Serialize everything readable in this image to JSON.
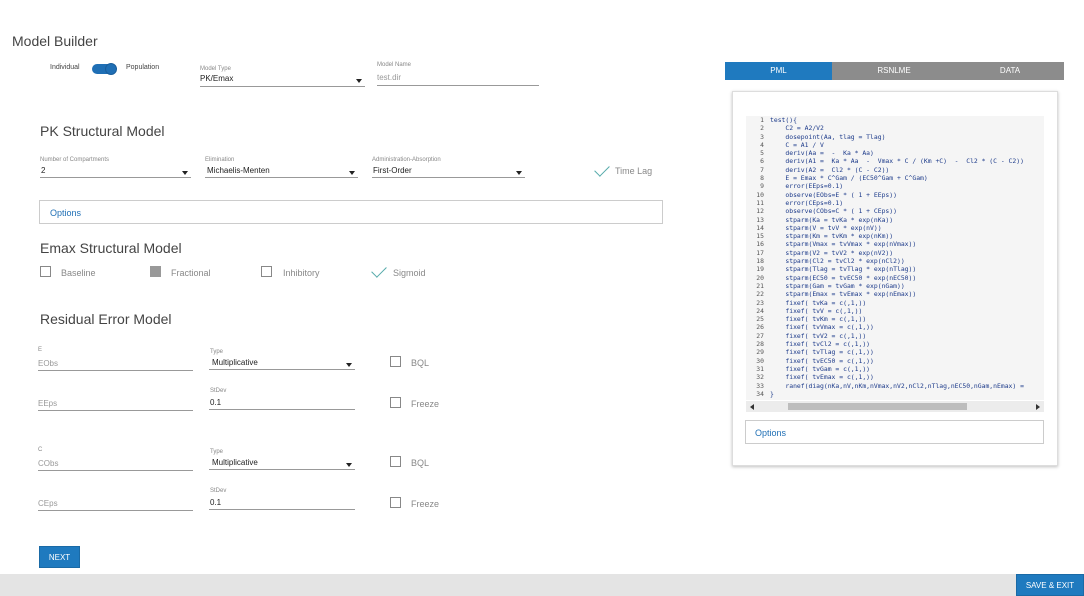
{
  "app": {
    "title": "Model Builder"
  },
  "mode_toggle": {
    "left_label": "Individual",
    "right_label": "Population"
  },
  "model_type": {
    "label": "Model Type",
    "value": "PK/Emax"
  },
  "model_name": {
    "label": "Model Name",
    "placeholder": "test.dir"
  },
  "pk": {
    "title": "PK Structural Model",
    "compartments": {
      "label": "Number of Compartments",
      "value": "2"
    },
    "elimination": {
      "label": "Elimination",
      "value": "Michaelis-Menten"
    },
    "absorption": {
      "label": "Administration-Absorption",
      "value": "First-Order"
    },
    "time_lag": {
      "label": "Time Lag"
    },
    "options_label": "Options"
  },
  "emax": {
    "title": "Emax Structural Model",
    "baseline": "Baseline",
    "fractional": "Fractional",
    "inhibitory": "Inhibitory",
    "sigmoid": "Sigmoid"
  },
  "residual": {
    "title": "Residual Error Model",
    "e_block": {
      "var_label": "E",
      "obs_placeholder": "EObs",
      "type_label": "Type",
      "type_value": "Multiplicative",
      "bql_label": "BQL",
      "eps_placeholder": "EEps",
      "stdev_label": "StDev",
      "stdev_value": "0.1",
      "freeze_label": "Freeze"
    },
    "c_block": {
      "var_label": "C",
      "obs_placeholder": "CObs",
      "type_label": "Type",
      "type_value": "Multiplicative",
      "bql_label": "BQL",
      "eps_placeholder": "CEps",
      "stdev_label": "StDev",
      "stdev_value": "0.1",
      "freeze_label": "Freeze"
    }
  },
  "buttons": {
    "next": "NEXT",
    "save_exit": "SAVE & EXIT"
  },
  "tabs": [
    {
      "label": "PML",
      "active": true
    },
    {
      "label": "RSNLME",
      "active": false
    },
    {
      "label": "DATA",
      "active": false
    }
  ],
  "code": {
    "lines": [
      {
        "n": "1",
        "t": "test(){"
      },
      {
        "n": "2",
        "t": "    C2 = A2/V2"
      },
      {
        "n": "3",
        "t": "    dosepoint(Aa, tlag = Tlag)"
      },
      {
        "n": "4",
        "t": "    C = A1 / V"
      },
      {
        "n": "5",
        "t": "    deriv(Aa =  -  Ka * Aa)"
      },
      {
        "n": "6",
        "t": "    deriv(A1 =  Ka * Aa  -  Vmax * C / (Km +C)  -  Cl2 * (C - C2))"
      },
      {
        "n": "7",
        "t": "    deriv(A2 =  Cl2 * (C - C2))"
      },
      {
        "n": "8",
        "t": "    E = Emax * C^Gam / (EC50^Gam + C^Gam)"
      },
      {
        "n": "9",
        "t": "    error(EEps=0.1)"
      },
      {
        "n": "10",
        "t": "    observe(EObs=E * ( 1 + EEps))"
      },
      {
        "n": "11",
        "t": "    error(CEps=0.1)"
      },
      {
        "n": "12",
        "t": "    observe(CObs=C * ( 1 + CEps))"
      },
      {
        "n": "13",
        "t": "    stparm(Ka = tvKa * exp(nKa))"
      },
      {
        "n": "14",
        "t": "    stparm(V = tvV * exp(nV))"
      },
      {
        "n": "15",
        "t": "    stparm(Km = tvKm * exp(nKm))"
      },
      {
        "n": "16",
        "t": "    stparm(Vmax = tvVmax * exp(nVmax))"
      },
      {
        "n": "17",
        "t": "    stparm(V2 = tvV2 * exp(nV2))"
      },
      {
        "n": "18",
        "t": "    stparm(Cl2 = tvCl2 * exp(nCl2))"
      },
      {
        "n": "19",
        "t": "    stparm(Tlag = tvTlag * exp(nTlag))"
      },
      {
        "n": "20",
        "t": "    stparm(EC50 = tvEC50 * exp(nEC50))"
      },
      {
        "n": "21",
        "t": "    stparm(Gam = tvGam * exp(nGam))"
      },
      {
        "n": "22",
        "t": "    stparm(Emax = tvEmax * exp(nEmax))"
      },
      {
        "n": "23",
        "t": "    fixef( tvKa = c(,1,))"
      },
      {
        "n": "24",
        "t": "    fixef( tvV = c(,1,))"
      },
      {
        "n": "25",
        "t": "    fixef( tvKm = c(,1,))"
      },
      {
        "n": "26",
        "t": "    fixef( tvVmax = c(,1,))"
      },
      {
        "n": "27",
        "t": "    fixef( tvV2 = c(,1,))"
      },
      {
        "n": "28",
        "t": "    fixef( tvCl2 = c(,1,))"
      },
      {
        "n": "29",
        "t": "    fixef( tvTlag = c(,1,))"
      },
      {
        "n": "30",
        "t": "    fixef( tvEC50 = c(,1,))"
      },
      {
        "n": "31",
        "t": "    fixef( tvGam = c(,1,))"
      },
      {
        "n": "32",
        "t": "    fixef( tvEmax = c(,1,))"
      },
      {
        "n": "33",
        "t": "    ranef(diag(nKa,nV,nKm,nVmax,nV2,nCl2,nTlag,nEC50,nGam,nEmax) = "
      },
      {
        "n": "34",
        "t": "}"
      }
    ],
    "options_label": "Options"
  },
  "colors": {
    "accent": "#1f7abf",
    "tab_inactive": "#8c8c8c",
    "bottom_bar": "#e4e4e4"
  }
}
